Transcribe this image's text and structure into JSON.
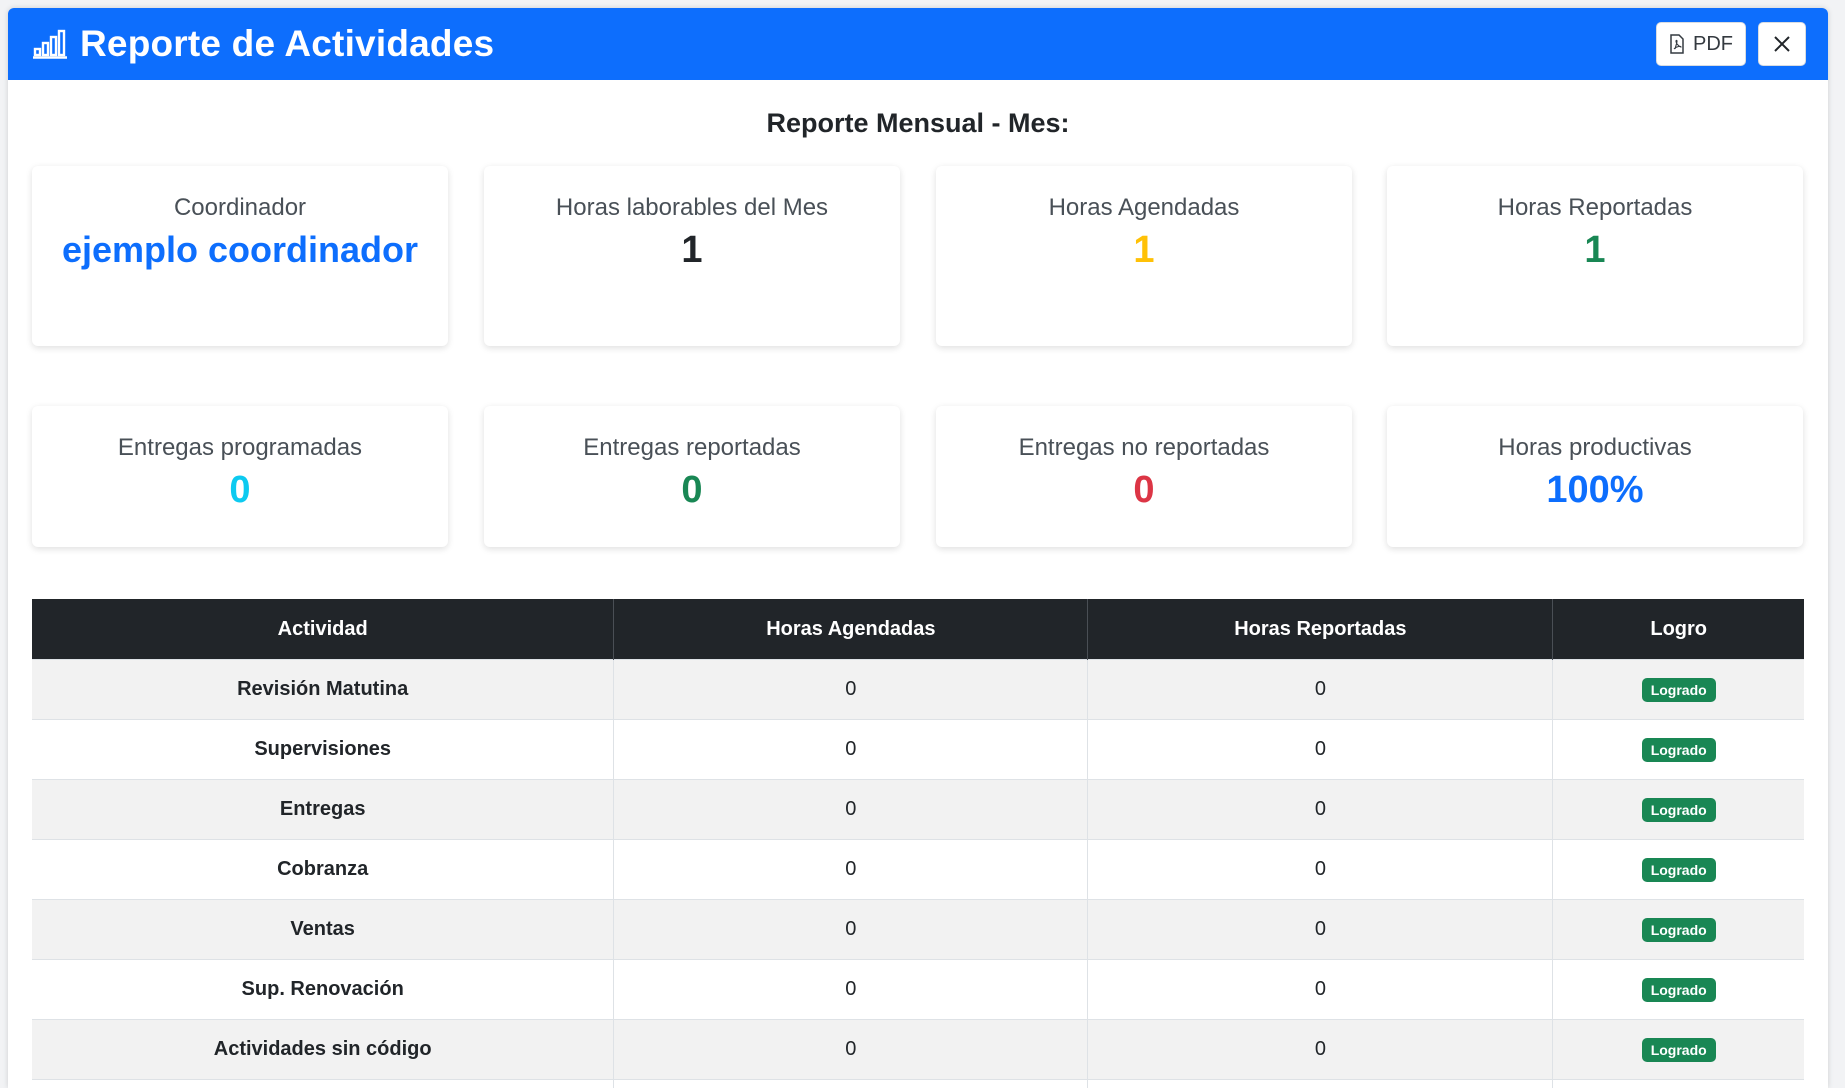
{
  "header": {
    "title": "Reporte de Actividades",
    "pdf_label": "PDF",
    "icon": "bar-chart-icon",
    "accent_color": "#0d6efd"
  },
  "report_title": "Reporte Mensual - Mes:",
  "cards": [
    {
      "label": "Coordinador",
      "value": "ejemplo coordinador",
      "color": "#0d6efd"
    },
    {
      "label": "Horas laborables del Mes",
      "value": "1",
      "color": "#212529"
    },
    {
      "label": "Horas Agendadas",
      "value": "1",
      "color": "#ffc107"
    },
    {
      "label": "Horas Reportadas",
      "value": "1",
      "color": "#198754"
    },
    {
      "label": "Entregas programadas",
      "value": "0",
      "color": "#0dcaf0"
    },
    {
      "label": "Entregas reportadas",
      "value": "0",
      "color": "#198754"
    },
    {
      "label": "Entregas no reportadas",
      "value": "0",
      "color": "#dc3545"
    },
    {
      "label": "Horas productivas",
      "value": "100%",
      "color": "#0d6efd"
    }
  ],
  "table": {
    "headers": [
      "Actividad",
      "Horas Agendadas",
      "Horas Reportadas",
      "Logro"
    ],
    "rows": [
      {
        "actividad": "Revisión Matutina",
        "agendadas": "0",
        "reportadas": "0",
        "logro": "Logrado"
      },
      {
        "actividad": "Supervisiones",
        "agendadas": "0",
        "reportadas": "0",
        "logro": "Logrado"
      },
      {
        "actividad": "Entregas",
        "agendadas": "0",
        "reportadas": "0",
        "logro": "Logrado"
      },
      {
        "actividad": "Cobranza",
        "agendadas": "0",
        "reportadas": "0",
        "logro": "Logrado"
      },
      {
        "actividad": "Ventas",
        "agendadas": "0",
        "reportadas": "0",
        "logro": "Logrado"
      },
      {
        "actividad": "Sup. Renovación",
        "agendadas": "0",
        "reportadas": "0",
        "logro": "Logrado"
      },
      {
        "actividad": "Actividades sin código",
        "agendadas": "0",
        "reportadas": "0",
        "logro": "Logrado"
      },
      {
        "actividad": "",
        "agendadas": "",
        "reportadas": "",
        "logro": ""
      }
    ]
  }
}
